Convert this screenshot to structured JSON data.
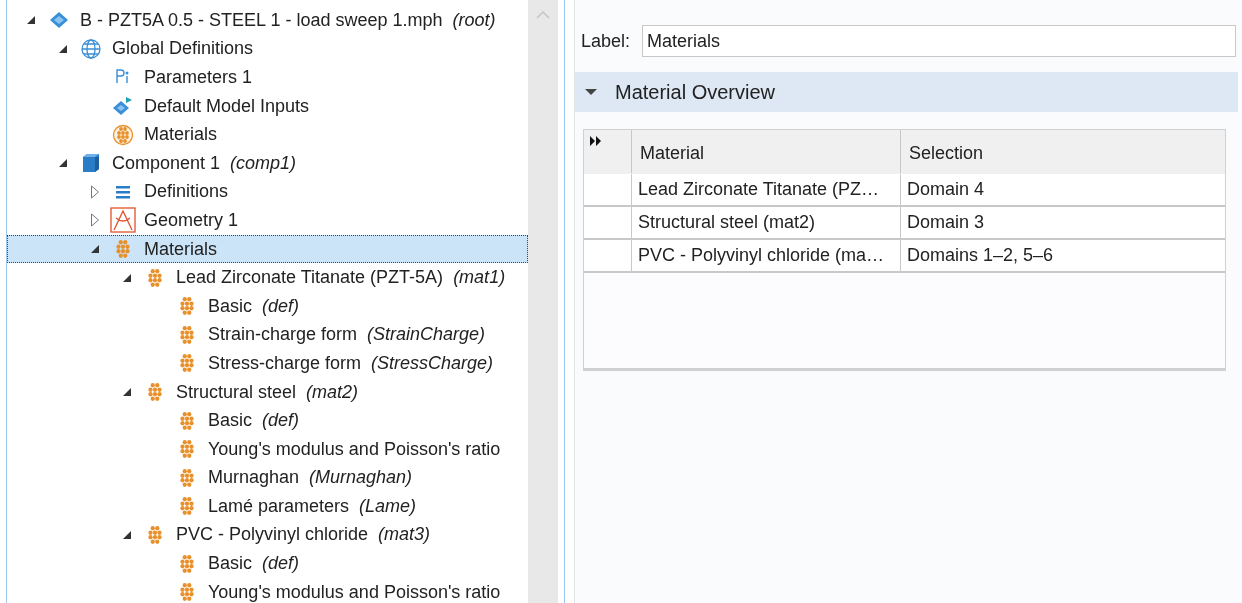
{
  "tree": [
    {
      "label": "B - PZT5A 0.5 - STEEL 1 - load sweep 1.mph",
      "tag": "(root)",
      "kind": "file",
      "expanded": true,
      "selected": false,
      "children": [
        {
          "label": "Global Definitions",
          "kind": "globe",
          "expanded": true,
          "selected": false,
          "children": [
            {
              "label": "Parameters 1",
              "kind": "parameters",
              "selected": false
            },
            {
              "label": "Default Model Inputs",
              "kind": "inputs",
              "selected": false
            },
            {
              "label": "Materials",
              "kind": "materials",
              "selected": false
            }
          ]
        },
        {
          "label": "Component 1",
          "tag": "(comp1)",
          "kind": "component",
          "expanded": true,
          "selected": false,
          "children": [
            {
              "label": "Definitions",
              "kind": "definitions",
              "expanded": false,
              "selected": false
            },
            {
              "label": "Geometry 1",
              "kind": "geometry",
              "expanded": false,
              "selected": false
            },
            {
              "label": "Materials",
              "kind": "material",
              "expanded": true,
              "selected": true,
              "children": [
                {
                  "label": "Lead Zirconate Titanate (PZT-5A)",
                  "tag": "(mat1)",
                  "kind": "material",
                  "expanded": true,
                  "selected": false,
                  "children": [
                    {
                      "label": "Basic",
                      "tag": "(def)",
                      "kind": "material",
                      "selected": false
                    },
                    {
                      "label": "Strain-charge form",
                      "tag": "(StrainCharge)",
                      "kind": "material",
                      "selected": false
                    },
                    {
                      "label": "Stress-charge form",
                      "tag": "(StressCharge)",
                      "kind": "material",
                      "selected": false
                    }
                  ]
                },
                {
                  "label": "Structural steel",
                  "tag": "(mat2)",
                  "kind": "material",
                  "expanded": true,
                  "selected": false,
                  "children": [
                    {
                      "label": "Basic",
                      "tag": "(def)",
                      "kind": "material",
                      "selected": false
                    },
                    {
                      "label": "Young's modulus and Poisson's ratio",
                      "kind": "material",
                      "selected": false
                    },
                    {
                      "label": "Murnaghan",
                      "tag": "(Murnaghan)",
                      "kind": "material",
                      "selected": false
                    },
                    {
                      "label": "Lamé parameters",
                      "tag": "(Lame)",
                      "kind": "material",
                      "selected": false
                    }
                  ]
                },
                {
                  "label": "PVC - Polyvinyl chloride",
                  "tag": "(mat3)",
                  "kind": "material",
                  "expanded": true,
                  "selected": false,
                  "children": [
                    {
                      "label": "Basic",
                      "tag": "(def)",
                      "kind": "material",
                      "selected": false
                    },
                    {
                      "label": "Young's modulus and Poisson's ratio",
                      "kind": "material",
                      "selected": false
                    }
                  ]
                }
              ]
            }
          ]
        }
      ]
    }
  ],
  "settings": {
    "label_caption": "Label:",
    "label_value": "Materials",
    "section": {
      "title": "Material Overview",
      "expanded": true
    },
    "table": {
      "columns": [
        "Material",
        "Selection"
      ],
      "rows": [
        [
          "Lead Zirconate Titanate (PZ…",
          "Domain 4"
        ],
        [
          "Structural steel (mat2)",
          "Domain 3"
        ],
        [
          "PVC - Polyvinyl chloride (ma…",
          "Domains 1–2, 5–6"
        ]
      ]
    }
  }
}
